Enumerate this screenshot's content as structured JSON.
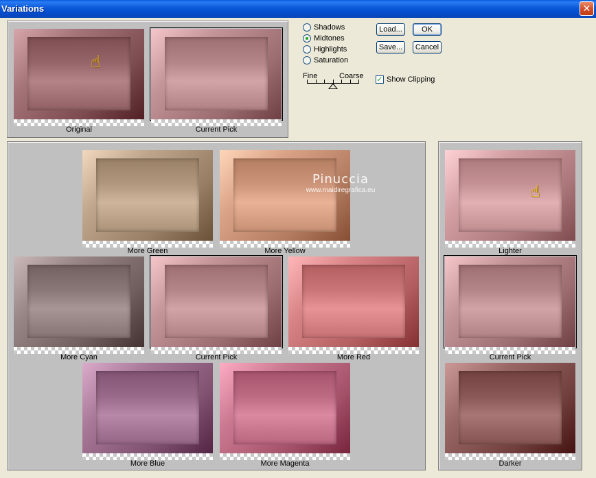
{
  "window": {
    "title": "Variations"
  },
  "icons": {
    "close": "close-icon",
    "pointer": "pointing-hand-icon"
  },
  "options": {
    "radios": [
      {
        "label": "Shadows",
        "checked": false
      },
      {
        "label": "Midtones",
        "checked": true
      },
      {
        "label": "Highlights",
        "checked": false
      },
      {
        "label": "Saturation",
        "checked": false
      }
    ],
    "slider": {
      "left_label": "Fine",
      "right_label": "Coarse"
    },
    "show_clipping": {
      "label": "Show Clipping",
      "checked": true
    }
  },
  "buttons": {
    "load": "Load...",
    "save": "Save...",
    "ok": "OK",
    "cancel": "Cancel"
  },
  "preview": {
    "original": "Original",
    "current": "Current Pick"
  },
  "variations": {
    "more_green": "More Green",
    "more_yellow": "More Yellow",
    "more_cyan": "More Cyan",
    "current": "Current Pick",
    "more_red": "More Red",
    "more_blue": "More Blue",
    "more_magenta": "More Magenta"
  },
  "brightness": {
    "lighter": "Lighter",
    "current": "Current Pick",
    "darker": "Darker"
  },
  "watermark": {
    "line1": "Pinuccia",
    "line2": "www.maidiregrafica.eu"
  },
  "colors": {
    "original": "#9a6a6e",
    "current": "#b98a8e",
    "more_green": "#b59c82",
    "more_yellow": "#d19a7e",
    "more_cyan": "#8f7c7c",
    "more_red": "#cf7b7d",
    "more_blue": "#9e6f8e",
    "more_magenta": "#c26f88",
    "lighter": "#c9969a",
    "darker": "#8f5e5c"
  }
}
